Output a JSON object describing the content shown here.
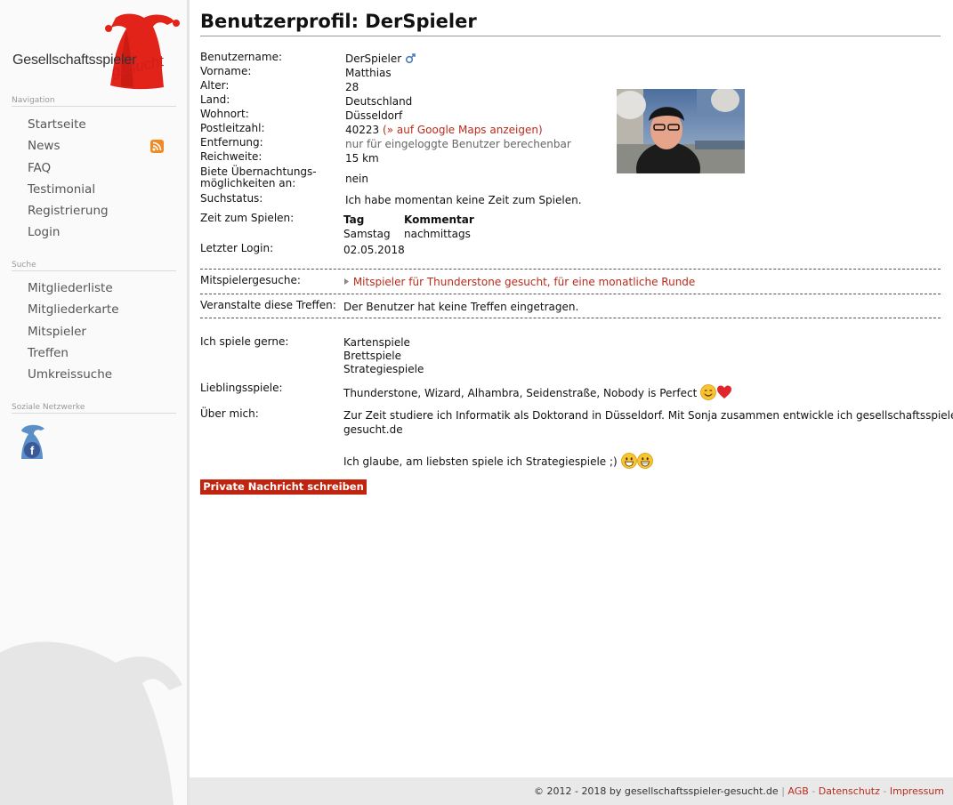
{
  "logo": {
    "text1": "Gesellschaftsspieler",
    "text2": "gesucht"
  },
  "sidebar": {
    "navigation_heading": "Navigation",
    "navigation": [
      "Startseite",
      "News",
      "FAQ",
      "Testimonial",
      "Registrierung",
      "Login"
    ],
    "search_heading": "Suche",
    "search": [
      "Mitgliederliste",
      "Mitgliederkarte",
      "Mitspieler",
      "Treffen",
      "Umkreissuche"
    ],
    "social_heading": "Soziale Netzwerke"
  },
  "profile": {
    "title": "Benutzerprofil: DerSpieler",
    "fields": [
      {
        "label": "Benutzername:",
        "value": "DerSpieler"
      },
      {
        "label": "Vorname:",
        "value": "Matthias"
      },
      {
        "label": "Alter:",
        "value": "28"
      },
      {
        "label": "Land:",
        "value": "Deutschland"
      },
      {
        "label": "Wohnort:",
        "value": "Düsseldorf"
      },
      {
        "label": "Postleitzahl:",
        "value": "40223",
        "link": "(» auf Google Maps anzeigen)"
      },
      {
        "label": "Entfernung:",
        "value": "nur für eingeloggte Benutzer berechenbar"
      },
      {
        "label": "Reichweite:",
        "value": "15 km"
      },
      {
        "label": "Biete Übernachtungs-möglichkeiten an:",
        "label_line1": "Biete Übernachtungs-",
        "label_line2": "möglichkeiten an:",
        "value": "nein"
      },
      {
        "label": "Suchstatus:",
        "value": "Ich habe momentan keine Zeit zum Spielen."
      }
    ],
    "play_time": {
      "label": "Zeit zum Spielen:",
      "col_day": "Tag",
      "col_comment": "Kommentar",
      "rows": [
        {
          "day": "Samstag",
          "comment": "nachmittags"
        }
      ]
    },
    "last_login": {
      "label": "Letzter Login:",
      "value": "02.05.2018"
    },
    "player_search": {
      "label": "Mitspielergesuche:",
      "link": "Mitspieler für Thunderstone gesucht, für eine monatliche Runde"
    },
    "meetings": {
      "label": "Veranstalte diese Treffen:",
      "value": "Der Benutzer hat keine Treffen eingetragen."
    },
    "likes": {
      "label": "Ich spiele gerne:",
      "items": [
        "Kartenspiele",
        "Brettspiele",
        "Strategiespiele"
      ]
    },
    "favorites": {
      "label": "Lieblingsspiele:",
      "value": "Thunderstone, Wizard, Alhambra, Seidenstraße, Nobody is Perfect"
    },
    "about": {
      "label": "Über mich:",
      "line1": "Zur Zeit studiere ich Informatik als Doktorand in Düsseldorf. Mit Sonja zusammen entwickle ich gesellschaftsspieler-",
      "line2": "gesucht.de",
      "line3": "Ich glaube, am liebsten spiele ich Strategiespiele ;)"
    },
    "pm_button": "Private Nachricht schreiben"
  },
  "footer": {
    "copyright": "© 2012 - 2018 by gesellschaftsspieler-gesucht.de",
    "sep1": "|",
    "agb": "AGB",
    "sep2": "-",
    "datenschutz": "Datenschutz",
    "sep3": "-",
    "impressum": "Impressum"
  },
  "colors": {
    "accent": "#c2230f",
    "link": "#b92b1b",
    "rss": "#f08a24"
  }
}
